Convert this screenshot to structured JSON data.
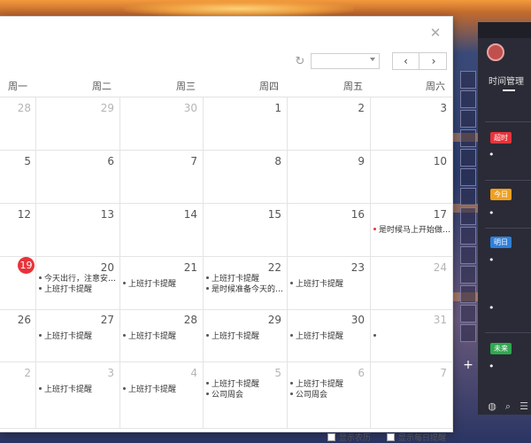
{
  "calendar": {
    "weekdays": [
      "周一",
      "周二",
      "周三",
      "周四",
      "周五",
      "周六"
    ],
    "rows": [
      {
        "days": [
          "28",
          "29",
          "30",
          "1",
          "2",
          "3"
        ]
      },
      {
        "days": [
          "5",
          "6",
          "7",
          "8",
          "9",
          "10"
        ]
      },
      {
        "days": [
          "12",
          "13",
          "14",
          "15",
          "16",
          "17"
        ]
      },
      {
        "days": [
          "19",
          "20",
          "21",
          "22",
          "23",
          "24"
        ]
      },
      {
        "days": [
          "26",
          "27",
          "28",
          "29",
          "30",
          "31"
        ]
      },
      {
        "days": [
          "2",
          "3",
          "4",
          "5",
          "6",
          "7"
        ]
      }
    ],
    "events": {
      "r2c6": "是时候马上开始做…",
      "r3c1": "今天出行，注意安…",
      "r3c1b": "上班打卡提醒",
      "clock_in": "上班打卡提醒",
      "r3c3b": "是时候准备今天的…",
      "r5c3b": "公司周会",
      "r5c4b": "公司周会"
    },
    "footer": {
      "show_lunar": "显示农历",
      "show_daily": "显示每日提醒"
    }
  },
  "side_panel": {
    "title": "时间管理",
    "tags": {
      "overdue": "超时",
      "today": "今日",
      "tomorrow": "明日",
      "future": "未来"
    },
    "colors": {
      "overdue": "#e8333a",
      "today": "#f0a020",
      "tomorrow": "#2f7fd8",
      "future": "#2fa84f"
    }
  },
  "colors": {
    "today_badge": "#e8333a"
  }
}
